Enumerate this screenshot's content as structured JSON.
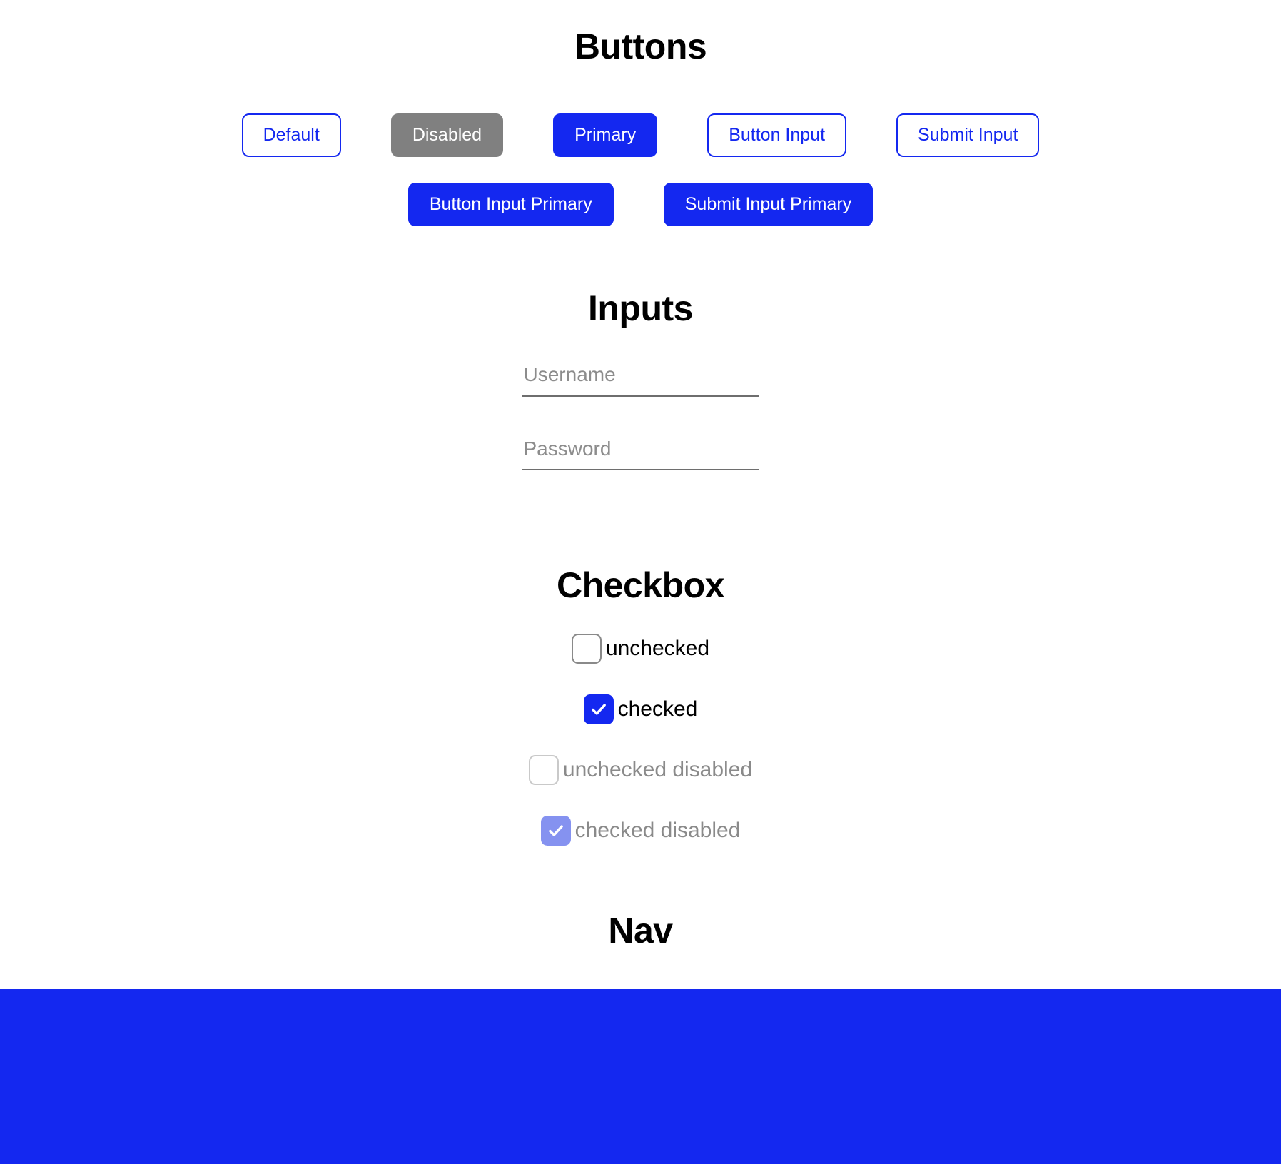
{
  "theme": {
    "primary_color": "#1428f0",
    "disabled_color": "#808080",
    "checked_disabled_color": "#8592f0",
    "border_gray": "#8a8a8a",
    "placeholder_gray": "#8c8c8c",
    "background": "#ffffff",
    "text_color": "#000000"
  },
  "sections": {
    "buttons": {
      "heading": "Buttons",
      "row1": [
        {
          "label": "Default",
          "variant": "default"
        },
        {
          "label": "Disabled",
          "variant": "disabled"
        },
        {
          "label": "Primary",
          "variant": "primary"
        },
        {
          "label": "Button Input",
          "variant": "default"
        },
        {
          "label": "Submit Input",
          "variant": "default"
        }
      ],
      "row2": [
        {
          "label": "Button Input Primary",
          "variant": "primary"
        },
        {
          "label": "Submit Input Primary",
          "variant": "primary"
        }
      ]
    },
    "inputs": {
      "heading": "Inputs",
      "fields": [
        {
          "name": "username",
          "placeholder": "Username",
          "value": "",
          "type": "text"
        },
        {
          "name": "password",
          "placeholder": "Password",
          "value": "",
          "type": "password"
        }
      ]
    },
    "checkbox": {
      "heading": "Checkbox",
      "items": [
        {
          "label": "unchecked",
          "checked": false,
          "disabled": false
        },
        {
          "label": "checked",
          "checked": true,
          "disabled": false
        },
        {
          "label": "unchecked disabled",
          "checked": false,
          "disabled": true
        },
        {
          "label": "checked disabled",
          "checked": true,
          "disabled": true
        }
      ]
    },
    "nav": {
      "heading": "Nav",
      "items": [
        {
          "label": ""
        }
      ]
    }
  }
}
